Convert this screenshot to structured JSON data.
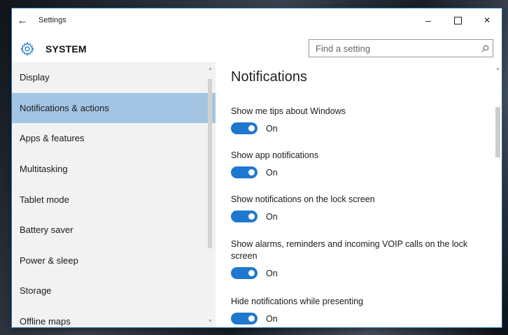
{
  "window": {
    "title": "Settings",
    "back_glyph": "←",
    "controls": {
      "minimize_glyph": "–",
      "close_glyph": "✕"
    }
  },
  "header": {
    "title": "SYSTEM",
    "icon": "gear-icon",
    "search_placeholder": "Find a setting"
  },
  "sidebar": {
    "items": [
      {
        "label": "Display"
      },
      {
        "label": "Notifications & actions",
        "selected": true
      },
      {
        "label": "Apps & features"
      },
      {
        "label": "Multitasking"
      },
      {
        "label": "Tablet mode"
      },
      {
        "label": "Battery saver"
      },
      {
        "label": "Power & sleep"
      },
      {
        "label": "Storage"
      },
      {
        "label": "Offline maps"
      }
    ]
  },
  "main": {
    "title": "Notifications",
    "settings": [
      {
        "label": "Show me tips about Windows",
        "state": "On"
      },
      {
        "label": "Show app notifications",
        "state": "On"
      },
      {
        "label": "Show notifications on the lock screen",
        "state": "On"
      },
      {
        "label": "Show alarms, reminders and incoming VOIP calls on the lock screen",
        "state": "On"
      },
      {
        "label": "Hide notifications while presenting",
        "state": "On"
      }
    ]
  },
  "colors": {
    "accent": "#1e78cf",
    "selected_item": "#a4c4e4",
    "sidebar_bg": "#f2f2f2"
  }
}
